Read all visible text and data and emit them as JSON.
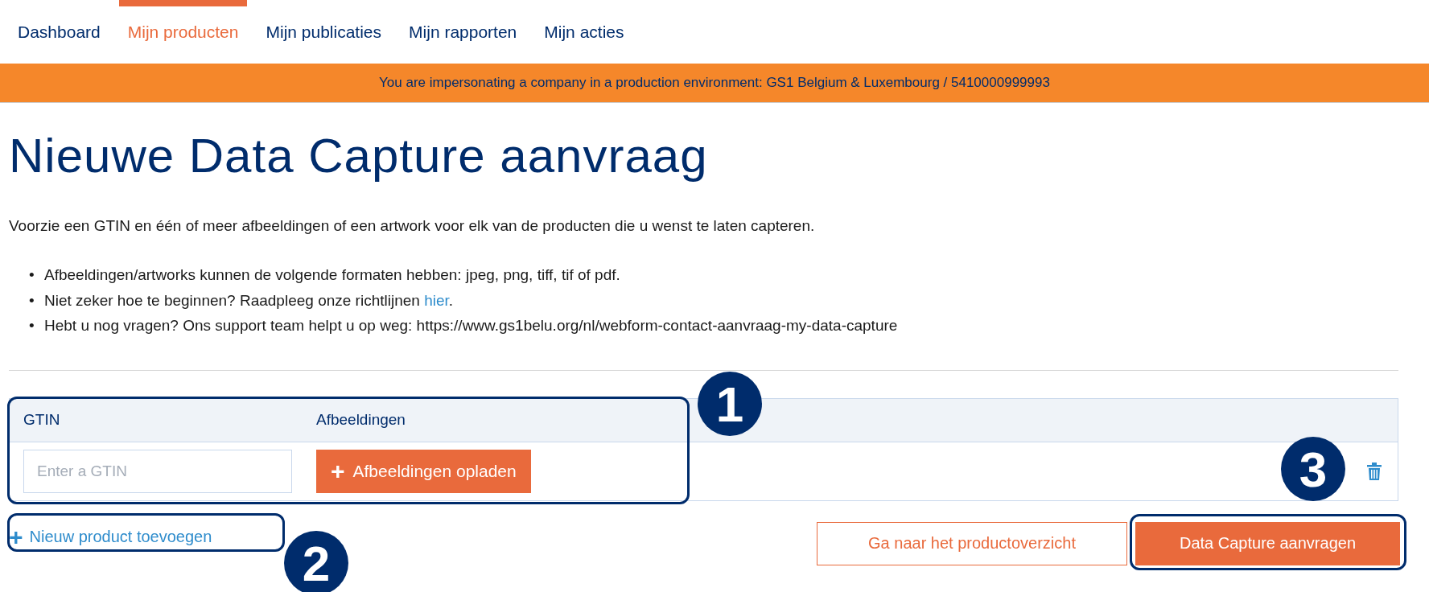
{
  "nav": [
    {
      "label": "Dashboard",
      "selected": false
    },
    {
      "label": "Mijn producten",
      "selected": true
    },
    {
      "label": "Mijn publicaties",
      "selected": false
    },
    {
      "label": "Mijn rapporten",
      "selected": false
    },
    {
      "label": "Mijn acties",
      "selected": false
    }
  ],
  "banner": "You are impersonating a company in a production environment: GS1 Belgium & Luxembourg / 5410000999993",
  "title": "Nieuwe Data Capture aanvraag",
  "intro": "Voorzie een GTIN en één of meer afbeeldingen of een artwork voor elk van de producten die u wenst te laten capteren.",
  "bullets": [
    {
      "marker": "•",
      "text": "Afbeeldingen/artworks kunnen de volgende formaten hebben: jpeg, png, tiff, tif of pdf."
    },
    {
      "marker": "•",
      "text": "Niet zeker hoe te beginnen? Raadpleeg onze richtlijnen ",
      "link": "hier",
      "after": "."
    },
    {
      "marker": "•",
      "text": "Hebt u nog vragen? Ons support team helpt u op weg: https://www.gs1belu.org/nl/webform-contact-aanvraag-my-data-capture"
    }
  ],
  "table": {
    "columns": [
      "GTIN",
      "Afbeeldingen"
    ],
    "rows": [
      {
        "gtin_placeholder": "Enter a GTIN",
        "upload_icon": "+",
        "upload_label": "Afbeeldingen opladen"
      }
    ]
  },
  "add_link": {
    "icon": "+",
    "label": "Nieuw product toevoegen"
  },
  "buttons": [
    {
      "label": "Ga naar het productoverzicht",
      "kind": "secondary"
    },
    {
      "label": "Data Capture aanvragen",
      "kind": "primary"
    }
  ],
  "annotations": [
    {
      "label": "1"
    },
    {
      "label": "2"
    },
    {
      "label": "3"
    }
  ]
}
